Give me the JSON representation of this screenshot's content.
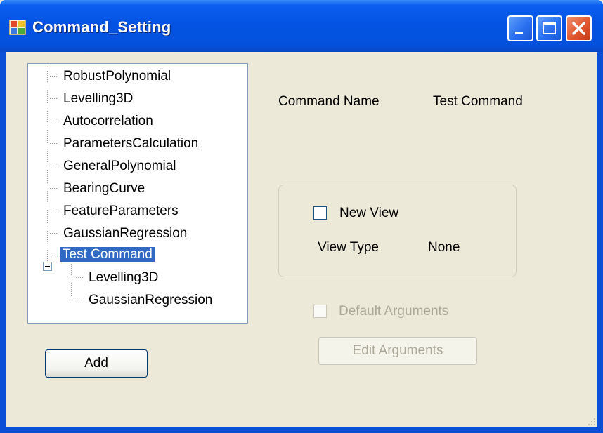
{
  "window": {
    "title": "Command_Setting"
  },
  "tree": {
    "items": [
      {
        "label": "RobustPolynomial",
        "level": 0
      },
      {
        "label": "Levelling3D",
        "level": 0
      },
      {
        "label": "Autocorrelation",
        "level": 0
      },
      {
        "label": "ParametersCalculation",
        "level": 0
      },
      {
        "label": "GeneralPolynomial",
        "level": 0
      },
      {
        "label": "BearingCurve",
        "level": 0
      },
      {
        "label": "FeatureParameters",
        "level": 0
      },
      {
        "label": "GaussianRegression",
        "level": 0
      },
      {
        "label": "Test Command",
        "level": 0,
        "selected": true,
        "expanded": true
      },
      {
        "label": "Levelling3D",
        "level": 1
      },
      {
        "label": "GaussianRegression",
        "level": 1
      }
    ]
  },
  "buttons": {
    "add": "Add",
    "edit_arguments": "Edit Arguments"
  },
  "command": {
    "name_label": "Command Name",
    "name_value": "Test Command"
  },
  "view": {
    "new_view_label": "New View",
    "type_label": "View Type",
    "type_value": "None"
  },
  "arguments": {
    "default_label": "Default Arguments"
  },
  "colors": {
    "title_bar": "#0553e3",
    "selection": "#316ac5",
    "window_bg": "#ece9d8"
  }
}
